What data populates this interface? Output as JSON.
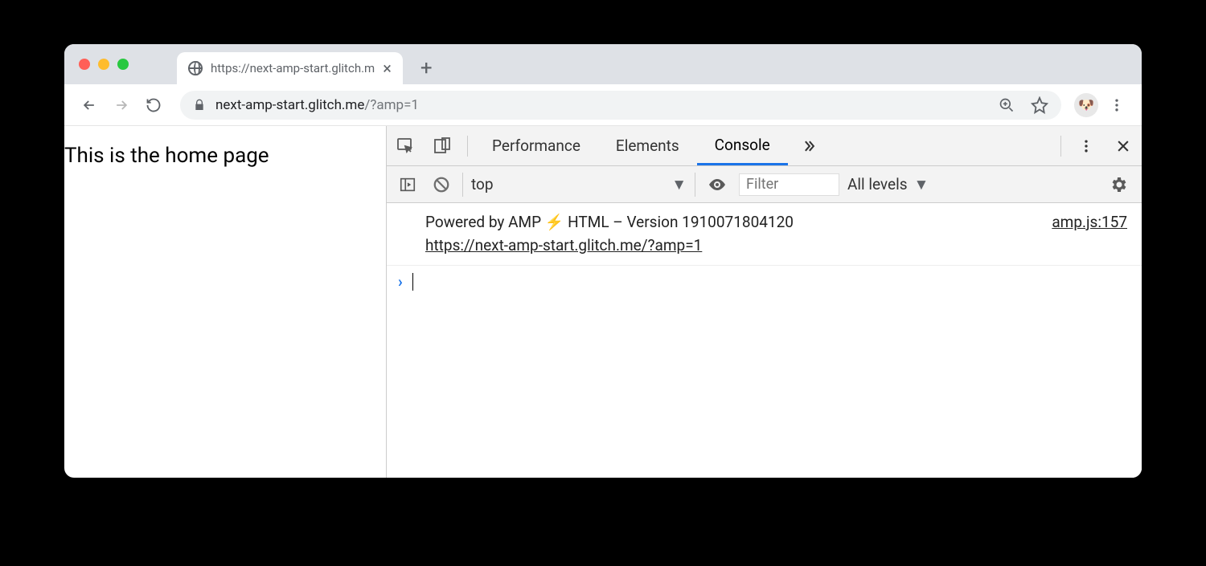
{
  "tab": {
    "title": "https://next-amp-start.glitch.m"
  },
  "address": {
    "host": "next-amp-start.glitch.me",
    "path": "/?amp=1"
  },
  "page": {
    "heading": "This is the home page"
  },
  "devtools": {
    "tabs": {
      "performance": "Performance",
      "elements": "Elements",
      "console": "Console"
    },
    "context": "top",
    "filter_placeholder": "Filter",
    "levels": "All levels",
    "log": {
      "text": "Powered by AMP ⚡ HTML – Version 1910071804120",
      "url": "https://next-amp-start.glitch.me/?amp=1",
      "src": "amp.js:157"
    }
  }
}
